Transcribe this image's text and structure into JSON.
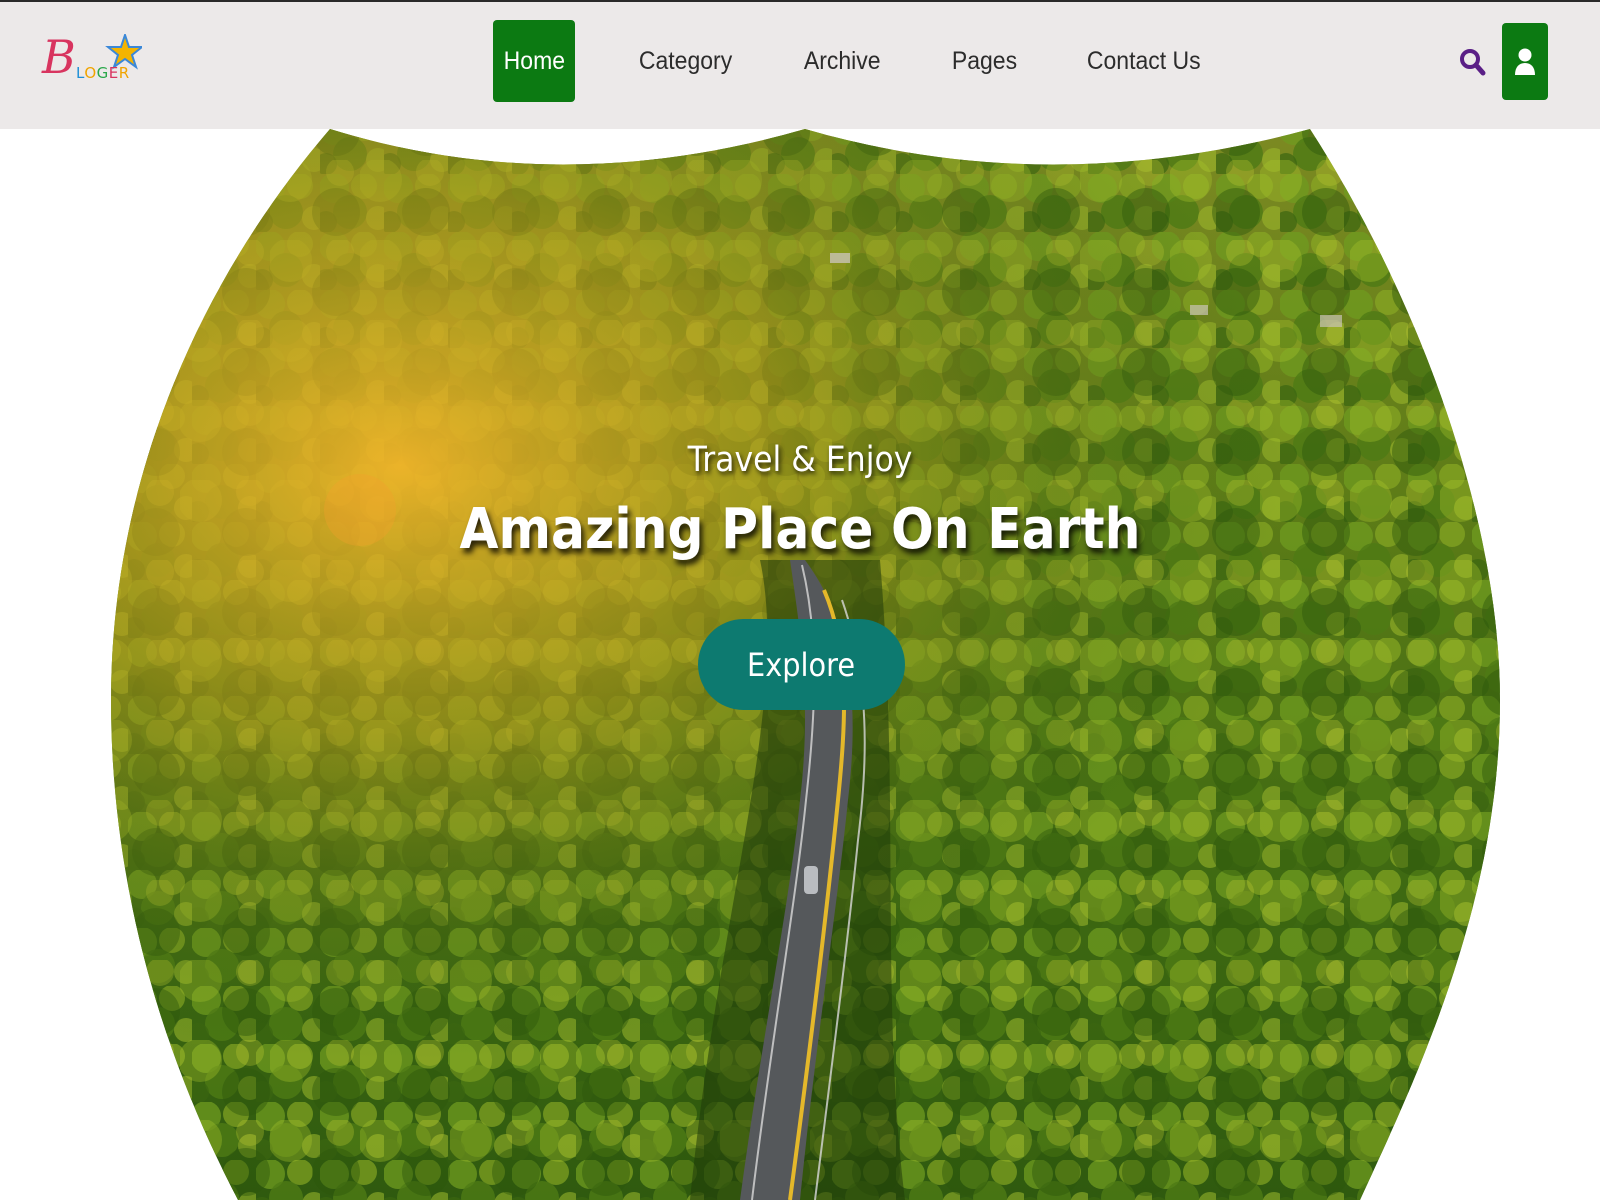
{
  "brand": {
    "logo_initial": "B",
    "logo_rest": [
      "L",
      "O",
      "G",
      "E",
      "R"
    ]
  },
  "nav": {
    "items": [
      {
        "label": "Home",
        "active": true
      },
      {
        "label": "Category",
        "active": false
      },
      {
        "label": "Archive",
        "active": false
      },
      {
        "label": "Pages",
        "active": false
      },
      {
        "label": "Contact Us",
        "active": false
      }
    ]
  },
  "header_icons": {
    "search": "search-icon",
    "user": "user-icon"
  },
  "hero": {
    "subtitle": "Travel & Enjoy",
    "title": "Amazing Place On Earth",
    "button_label": "Explore",
    "image": "aerial forest road photo"
  },
  "colors": {
    "header_bg": "#ece9e9",
    "nav_active": "#0c7a12",
    "user_button": "#0c7a12",
    "search_icon": "#5a1f86",
    "explore_button": "#0d7a70"
  }
}
